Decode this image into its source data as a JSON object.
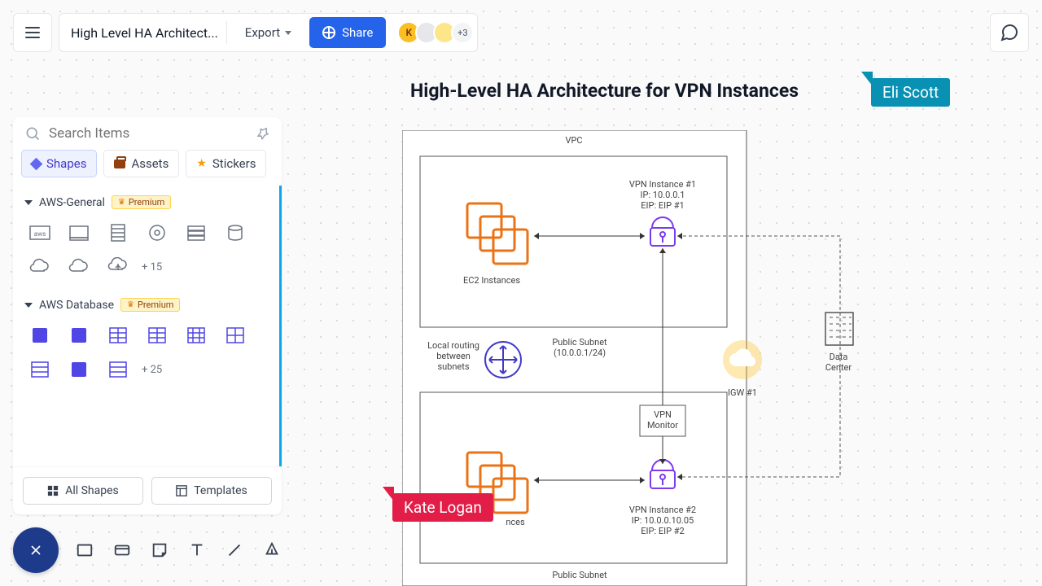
{
  "header": {
    "doc_title": "High Level HA Architect...",
    "export_label": "Export",
    "share_label": "Share",
    "avatar_more": "+3",
    "avatar_initial": "K"
  },
  "panel": {
    "search_placeholder": "Search Items",
    "tabs": {
      "shapes": "Shapes",
      "assets": "Assets",
      "stickers": "Stickers"
    },
    "cat1": {
      "name": "AWS-General",
      "badge": "Premium",
      "more": "+ 15"
    },
    "cat2": {
      "name": "AWS Database",
      "badge": "Premium",
      "more": "+ 25"
    },
    "footer": {
      "all_shapes": "All Shapes",
      "templates": "Templates"
    }
  },
  "diagram": {
    "title": "High-Level HA Architecture for VPN Instances",
    "vpc": "VPC",
    "ec2_instances": "EC2 Instances",
    "vpn1_name": "VPN Instance #1",
    "vpn1_ip": "IP: 10.0.0.1",
    "vpn1_eip": "EIP: EIP #1",
    "vpn2_name": "VPN Instance #2",
    "vpn2_ip": "IP: 10.0.0.10.05",
    "vpn2_eip": "EIP: EIP #2",
    "subnet1": "Public Subnet",
    "subnet1_cidr": "(10.0.0.1/24)",
    "subnet2": "Public Subnet",
    "local_routing_l1": "Local routing",
    "local_routing_l2": "between",
    "local_routing_l3": "subnets",
    "vpn_monitor": "VPN",
    "vpn_monitor2": "Monitor",
    "igw": "IGW #1",
    "data_center_l1": "Data",
    "data_center_l2": "Center"
  },
  "cursors": {
    "eli": "Eli Scott",
    "kate": "Kate Logan"
  }
}
